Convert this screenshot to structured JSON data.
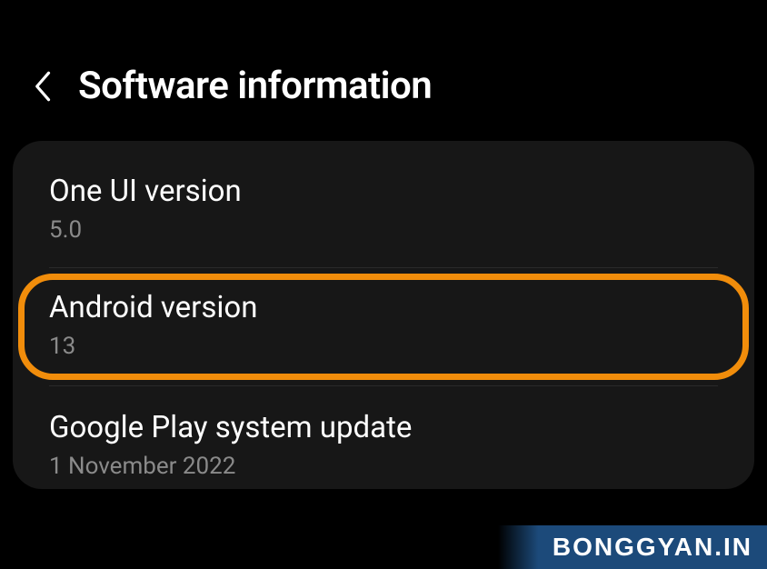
{
  "header": {
    "title": "Software information"
  },
  "settings": {
    "items": [
      {
        "label": "One UI version",
        "value": "5.0"
      },
      {
        "label": "Android version",
        "value": "13"
      },
      {
        "label": "Google Play system update",
        "value": "1 November 2022"
      }
    ]
  },
  "watermark": "BONGGYAN.IN",
  "highlight_color": "#f18d0b"
}
